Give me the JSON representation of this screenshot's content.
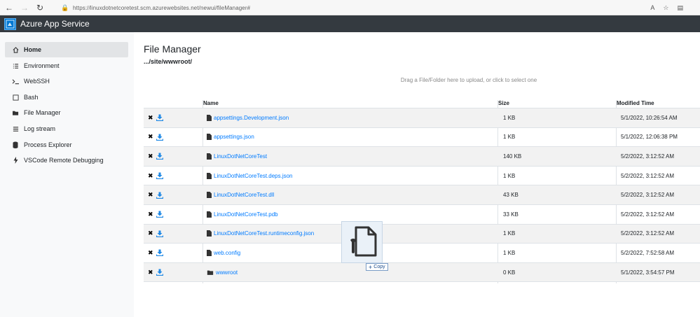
{
  "browser": {
    "url": "https://linuxdotnetcoretest.scm.azurewebsites.net/newui/fileManager#",
    "read_aloud_label": "A"
  },
  "app": {
    "title": "Azure App Service"
  },
  "sidebar": {
    "items": [
      {
        "label": "Home",
        "icon": "home-icon",
        "active": true
      },
      {
        "label": "Environment",
        "icon": "list-icon",
        "active": false
      },
      {
        "label": "WebSSH",
        "icon": "terminal-icon",
        "active": false
      },
      {
        "label": "Bash",
        "icon": "bash-icon",
        "active": false
      },
      {
        "label": "File Manager",
        "icon": "folder-open-icon",
        "active": false
      },
      {
        "label": "Log stream",
        "icon": "log-lines-icon",
        "active": false
      },
      {
        "label": "Process Explorer",
        "icon": "database-icon",
        "active": false
      },
      {
        "label": "VSCode Remote Debugging",
        "icon": "bolt-icon",
        "active": false
      }
    ]
  },
  "main": {
    "title": "File Manager",
    "path": ".../site/wwwroot/",
    "dropzone_text": "Drag a File/Folder here to upload, or click to select one",
    "columns": {
      "name": "Name",
      "size": "Size",
      "modified": "Modified Time"
    },
    "rows": [
      {
        "name": "appsettings.Development.json",
        "type": "file",
        "size": "1 KB",
        "modified": "5/1/2022, 10:26:54 AM"
      },
      {
        "name": "appsettings.json",
        "type": "file",
        "size": "1 KB",
        "modified": "5/1/2022, 12:06:38 PM"
      },
      {
        "name": "LinuxDotNetCoreTest",
        "type": "file",
        "size": "140 KB",
        "modified": "5/2/2022, 3:12:52 AM"
      },
      {
        "name": "LinuxDotNetCoreTest.deps.json",
        "type": "file",
        "size": "1 KB",
        "modified": "5/2/2022, 3:12:52 AM"
      },
      {
        "name": "LinuxDotNetCoreTest.dll",
        "type": "file",
        "size": "43 KB",
        "modified": "5/2/2022, 3:12:52 AM"
      },
      {
        "name": "LinuxDotNetCoreTest.pdb",
        "type": "file",
        "size": "33 KB",
        "modified": "5/2/2022, 3:12:52 AM"
      },
      {
        "name": "LinuxDotNetCoreTest.runtimeconfig.json",
        "type": "file",
        "size": "1 KB",
        "modified": "5/2/2022, 3:12:52 AM"
      },
      {
        "name": "web.config",
        "type": "file",
        "size": "1 KB",
        "modified": "5/2/2022, 7:52:58 AM"
      },
      {
        "name": "wwwroot",
        "type": "folder",
        "size": "0 KB",
        "modified": "5/1/2022, 3:54:57 PM"
      }
    ]
  },
  "drag": {
    "badge_label": "Copy"
  },
  "colors": {
    "header_bg": "#343a40",
    "link": "#007bff",
    "sidebar_bg": "#f8f9fa",
    "accent": "#0078d4"
  }
}
